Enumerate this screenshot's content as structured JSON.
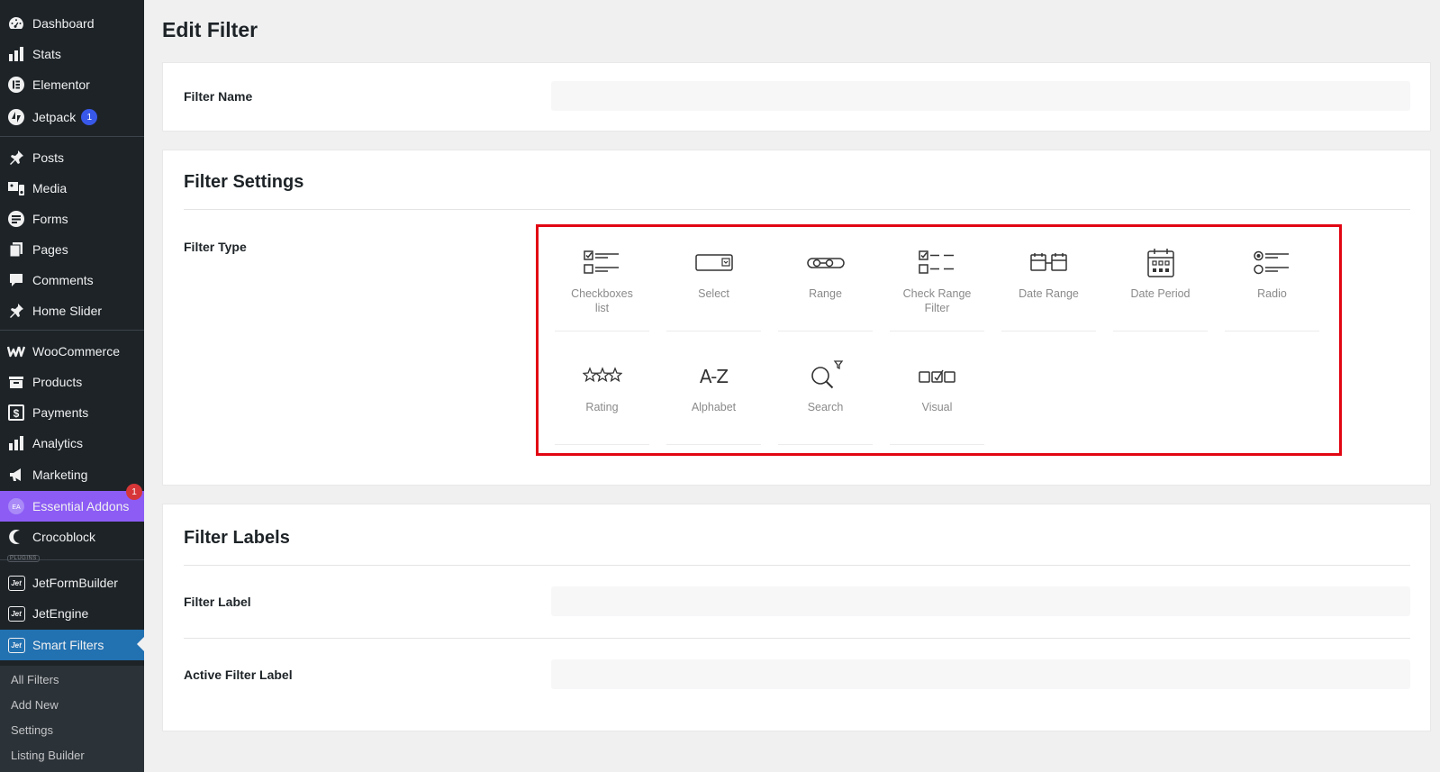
{
  "sidebar": {
    "items": [
      {
        "label": "Dashboard",
        "icon": "dashboard-icon"
      },
      {
        "label": "Stats",
        "icon": "stats-icon"
      },
      {
        "label": "Elementor",
        "icon": "elementor-icon"
      },
      {
        "label": "Jetpack",
        "icon": "jetpack-icon",
        "badge": "1"
      },
      {
        "label": "Posts",
        "icon": "pin-icon"
      },
      {
        "label": "Media",
        "icon": "media-icon"
      },
      {
        "label": "Forms",
        "icon": "forms-icon"
      },
      {
        "label": "Pages",
        "icon": "pages-icon"
      },
      {
        "label": "Comments",
        "icon": "comments-icon"
      },
      {
        "label": "Home Slider",
        "icon": "pin-icon"
      },
      {
        "label": "WooCommerce",
        "icon": "woocommerce-icon"
      },
      {
        "label": "Products",
        "icon": "products-icon"
      },
      {
        "label": "Payments",
        "icon": "payments-icon"
      },
      {
        "label": "Analytics",
        "icon": "analytics-icon"
      },
      {
        "label": "Marketing",
        "icon": "marketing-icon"
      },
      {
        "label": "Essential Addons",
        "icon": "essential-addons-icon",
        "badge": "1"
      },
      {
        "label": "Crocoblock",
        "icon": "crocoblock-icon"
      },
      {
        "label": "JetFormBuilder",
        "icon": "jet-icon"
      },
      {
        "label": "JetEngine",
        "icon": "jet-icon"
      },
      {
        "label": "Smart Filters",
        "icon": "jet-icon"
      }
    ],
    "plugins_tag": "PLUGINS",
    "submenu": [
      "All Filters",
      "Add New",
      "Settings",
      "Listing Builder"
    ],
    "jet_text": "Jet",
    "ea_text": "EA"
  },
  "page": {
    "title": "Edit Filter",
    "filter_name_label": "Filter Name",
    "settings_title": "Filter Settings",
    "filter_type_label": "Filter Type",
    "labels_title": "Filter Labels",
    "filter_label": "Filter Label",
    "active_filter_label": "Active Filter Label"
  },
  "filter_types": [
    {
      "label": "Checkboxes\nlist",
      "icon": "checkboxes-list-icon"
    },
    {
      "label": "Select",
      "icon": "select-icon"
    },
    {
      "label": "Range",
      "icon": "range-icon"
    },
    {
      "label": "Check Range\nFilter",
      "icon": "check-range-icon"
    },
    {
      "label": "Date Range",
      "icon": "date-range-icon"
    },
    {
      "label": "Date Period",
      "icon": "date-period-icon"
    },
    {
      "label": "Radio",
      "icon": "radio-icon"
    },
    {
      "label": "Rating",
      "icon": "rating-icon"
    },
    {
      "label": "Alphabet",
      "icon": "alphabet-icon"
    },
    {
      "label": "Search",
      "icon": "search-icon"
    },
    {
      "label": "Visual",
      "icon": "visual-icon"
    }
  ],
  "alphabet_glyph": "A-Z",
  "colors": {
    "sidebar_bg": "#1d2327",
    "current_menu": "#2271b1",
    "essential_addons": "#8c5cf5",
    "highlight_border": "#e20613"
  }
}
